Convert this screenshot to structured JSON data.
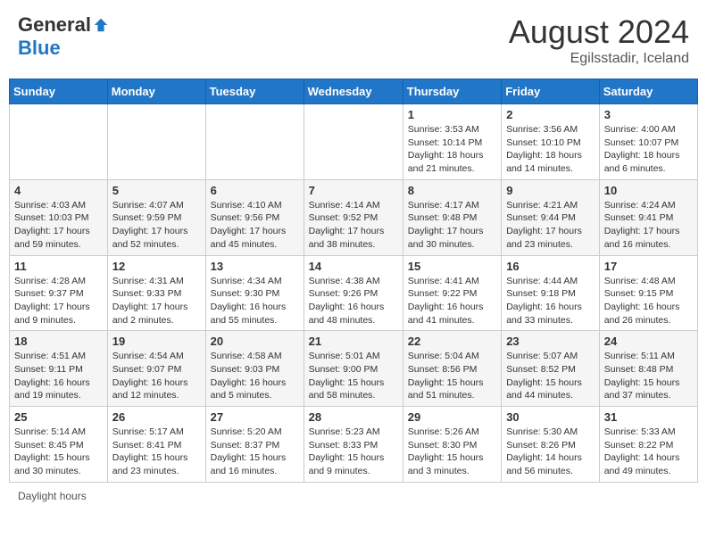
{
  "header": {
    "logo_general": "General",
    "logo_blue": "Blue",
    "month_title": "August 2024",
    "location": "Egilsstadir, Iceland"
  },
  "days_of_week": [
    "Sunday",
    "Monday",
    "Tuesday",
    "Wednesday",
    "Thursday",
    "Friday",
    "Saturday"
  ],
  "weeks": [
    [
      {
        "day": "",
        "info": ""
      },
      {
        "day": "",
        "info": ""
      },
      {
        "day": "",
        "info": ""
      },
      {
        "day": "",
        "info": ""
      },
      {
        "day": "1",
        "info": "Sunrise: 3:53 AM\nSunset: 10:14 PM\nDaylight: 18 hours\nand 21 minutes."
      },
      {
        "day": "2",
        "info": "Sunrise: 3:56 AM\nSunset: 10:10 PM\nDaylight: 18 hours\nand 14 minutes."
      },
      {
        "day": "3",
        "info": "Sunrise: 4:00 AM\nSunset: 10:07 PM\nDaylight: 18 hours\nand 6 minutes."
      }
    ],
    [
      {
        "day": "4",
        "info": "Sunrise: 4:03 AM\nSunset: 10:03 PM\nDaylight: 17 hours\nand 59 minutes."
      },
      {
        "day": "5",
        "info": "Sunrise: 4:07 AM\nSunset: 9:59 PM\nDaylight: 17 hours\nand 52 minutes."
      },
      {
        "day": "6",
        "info": "Sunrise: 4:10 AM\nSunset: 9:56 PM\nDaylight: 17 hours\nand 45 minutes."
      },
      {
        "day": "7",
        "info": "Sunrise: 4:14 AM\nSunset: 9:52 PM\nDaylight: 17 hours\nand 38 minutes."
      },
      {
        "day": "8",
        "info": "Sunrise: 4:17 AM\nSunset: 9:48 PM\nDaylight: 17 hours\nand 30 minutes."
      },
      {
        "day": "9",
        "info": "Sunrise: 4:21 AM\nSunset: 9:44 PM\nDaylight: 17 hours\nand 23 minutes."
      },
      {
        "day": "10",
        "info": "Sunrise: 4:24 AM\nSunset: 9:41 PM\nDaylight: 17 hours\nand 16 minutes."
      }
    ],
    [
      {
        "day": "11",
        "info": "Sunrise: 4:28 AM\nSunset: 9:37 PM\nDaylight: 17 hours\nand 9 minutes."
      },
      {
        "day": "12",
        "info": "Sunrise: 4:31 AM\nSunset: 9:33 PM\nDaylight: 17 hours\nand 2 minutes."
      },
      {
        "day": "13",
        "info": "Sunrise: 4:34 AM\nSunset: 9:30 PM\nDaylight: 16 hours\nand 55 minutes."
      },
      {
        "day": "14",
        "info": "Sunrise: 4:38 AM\nSunset: 9:26 PM\nDaylight: 16 hours\nand 48 minutes."
      },
      {
        "day": "15",
        "info": "Sunrise: 4:41 AM\nSunset: 9:22 PM\nDaylight: 16 hours\nand 41 minutes."
      },
      {
        "day": "16",
        "info": "Sunrise: 4:44 AM\nSunset: 9:18 PM\nDaylight: 16 hours\nand 33 minutes."
      },
      {
        "day": "17",
        "info": "Sunrise: 4:48 AM\nSunset: 9:15 PM\nDaylight: 16 hours\nand 26 minutes."
      }
    ],
    [
      {
        "day": "18",
        "info": "Sunrise: 4:51 AM\nSunset: 9:11 PM\nDaylight: 16 hours\nand 19 minutes."
      },
      {
        "day": "19",
        "info": "Sunrise: 4:54 AM\nSunset: 9:07 PM\nDaylight: 16 hours\nand 12 minutes."
      },
      {
        "day": "20",
        "info": "Sunrise: 4:58 AM\nSunset: 9:03 PM\nDaylight: 16 hours\nand 5 minutes."
      },
      {
        "day": "21",
        "info": "Sunrise: 5:01 AM\nSunset: 9:00 PM\nDaylight: 15 hours\nand 58 minutes."
      },
      {
        "day": "22",
        "info": "Sunrise: 5:04 AM\nSunset: 8:56 PM\nDaylight: 15 hours\nand 51 minutes."
      },
      {
        "day": "23",
        "info": "Sunrise: 5:07 AM\nSunset: 8:52 PM\nDaylight: 15 hours\nand 44 minutes."
      },
      {
        "day": "24",
        "info": "Sunrise: 5:11 AM\nSunset: 8:48 PM\nDaylight: 15 hours\nand 37 minutes."
      }
    ],
    [
      {
        "day": "25",
        "info": "Sunrise: 5:14 AM\nSunset: 8:45 PM\nDaylight: 15 hours\nand 30 minutes."
      },
      {
        "day": "26",
        "info": "Sunrise: 5:17 AM\nSunset: 8:41 PM\nDaylight: 15 hours\nand 23 minutes."
      },
      {
        "day": "27",
        "info": "Sunrise: 5:20 AM\nSunset: 8:37 PM\nDaylight: 15 hours\nand 16 minutes."
      },
      {
        "day": "28",
        "info": "Sunrise: 5:23 AM\nSunset: 8:33 PM\nDaylight: 15 hours\nand 9 minutes."
      },
      {
        "day": "29",
        "info": "Sunrise: 5:26 AM\nSunset: 8:30 PM\nDaylight: 15 hours\nand 3 minutes."
      },
      {
        "day": "30",
        "info": "Sunrise: 5:30 AM\nSunset: 8:26 PM\nDaylight: 14 hours\nand 56 minutes."
      },
      {
        "day": "31",
        "info": "Sunrise: 5:33 AM\nSunset: 8:22 PM\nDaylight: 14 hours\nand 49 minutes."
      }
    ]
  ],
  "footer": {
    "daylight_hours": "Daylight hours"
  }
}
